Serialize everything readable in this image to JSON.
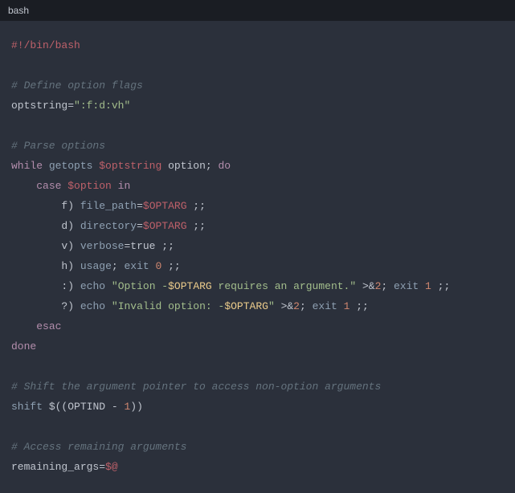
{
  "header": {
    "language": "bash"
  },
  "code": {
    "shebang": "#!/bin/bash",
    "c_define_flags": "# Define option flags",
    "optstring_name": "optstring",
    "eq": "=",
    "optstring_val": "\":f:d:vh\"",
    "c_parse": "# Parse options",
    "while": "while",
    "getopts": "getopts",
    "optstring_ref": "$optstring",
    "option_word": " option",
    "semi_do": "; ",
    "do": "do",
    "case": "case",
    "option_ref": "$option",
    "in": "in",
    "f_lbl": "f",
    "paren": ")",
    "file_path": "file_path",
    "optarg": "$OPTARG",
    "dsemi": " ;;",
    "d_lbl": "d",
    "directory": "directory",
    "v_lbl": "v",
    "verbose": "verbose",
    "true_val": "true",
    "h_lbl": "h",
    "usage": "usage",
    "exit": "exit",
    "zero": "0",
    "colon_lbl": ":",
    "echo": "echo",
    "msg_req1": "\"Option -",
    "msg_req2": " requires an argument.\"",
    "redir": ">&",
    "two": "2",
    "one": "1",
    "q_lbl": "?",
    "msg_inv1": "\"Invalid option: -",
    "msg_inv2": "\"",
    "semi": "; ",
    "esac": "esac",
    "done": "done",
    "c_shift": "# Shift the argument pointer to access non-option arguments",
    "shift": "shift",
    "arith_open": "$((",
    "optind": "OPTIND",
    "minus1": " - ",
    "arith_close": "))",
    "c_remaining": "# Access remaining arguments",
    "remaining": "remaining_args",
    "atargs": "$@"
  }
}
